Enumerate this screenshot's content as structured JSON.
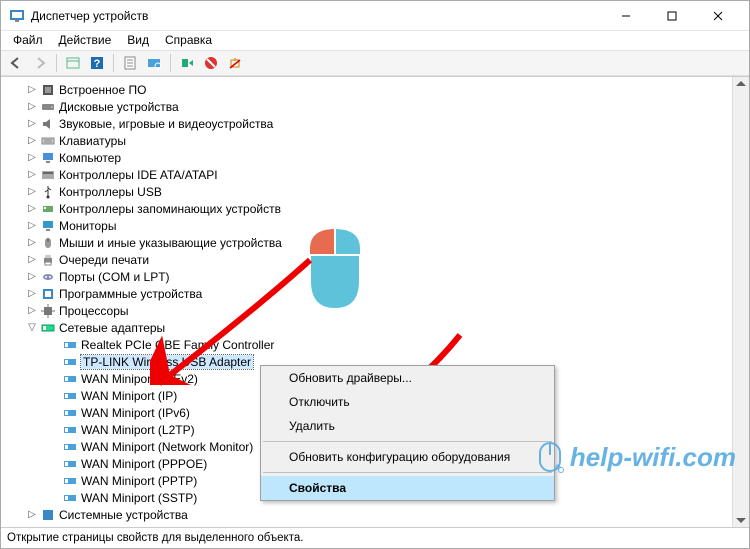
{
  "title": "Диспетчер устройств",
  "menu": {
    "file": "Файл",
    "action": "Действие",
    "view": "Вид",
    "help": "Справка"
  },
  "tree": {
    "collapsed": [
      "Встроенное ПО",
      "Дисковые устройства",
      "Звуковые, игровые и видеоустройства",
      "Клавиатуры",
      "Компьютер",
      "Контроллеры IDE ATA/ATAPI",
      "Контроллеры USB",
      "Контроллеры запоминающих устройств",
      "Мониторы",
      "Мыши и иные указывающие устройства",
      "Очереди печати",
      "Порты (COM и LPT)",
      "Программные устройства",
      "Процессоры"
    ],
    "net_label": "Сетевые адаптеры",
    "net_children": [
      "Realtek PCIe GBE Family Controller",
      "TP-LINK Wireless USB Adapter",
      "WAN Miniport (IKEv2)",
      "WAN Miniport (IP)",
      "WAN Miniport (IPv6)",
      "WAN Miniport (L2TP)",
      "WAN Miniport (Network Monitor)",
      "WAN Miniport (PPPOE)",
      "WAN Miniport (PPTP)",
      "WAN Miniport (SSTP)"
    ],
    "selected_index": 1,
    "cut_off": "Системные устройства"
  },
  "context_menu": {
    "items": [
      "Обновить драйверы...",
      "Отключить",
      "Удалить",
      "Обновить конфигурацию оборудования",
      "Свойства"
    ],
    "highlighted_index": 4
  },
  "statusbar": "Открытие страницы свойств для выделенного объекта.",
  "watermark": "help-wifi.com"
}
